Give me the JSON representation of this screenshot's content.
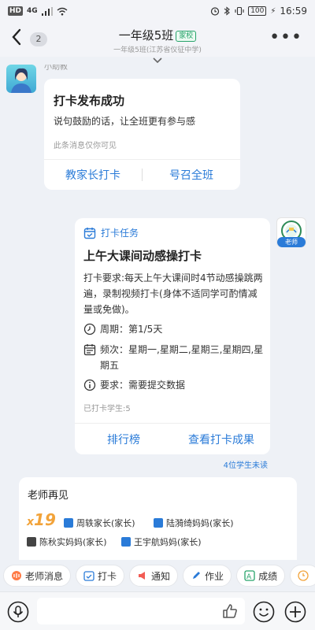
{
  "status_bar": {
    "time": "16:59",
    "network": "4G",
    "battery": "100",
    "hd_label": "HD"
  },
  "header": {
    "back_badge": "2",
    "title": "一年级5班",
    "tag": "家校",
    "subtitle": "一年级5班(江苏省仪征中学)"
  },
  "helper": {
    "name_partial": "小助教"
  },
  "card1": {
    "title": "打卡发布成功",
    "text": "说句鼓励的话，让全班更有参与感",
    "note": "此条消息仅你可见",
    "btn_left": "教家长打卡",
    "btn_right": "号召全班"
  },
  "teacher": {
    "tag": "老师"
  },
  "card2": {
    "head": "打卡任务",
    "title": "上午大课间动感操打卡",
    "requirement": "打卡要求:每天上午大课间时4节动感操跳两遍，录制视频打卡(身体不适同学可酌情减量或免做)。",
    "period": "周期：第1/5天",
    "frequency": "频次：星期一,星期二,星期三,星期四,星期五",
    "require": "要求：需要提交数据",
    "count": "已打卡学生:5",
    "btn_left": "排行榜",
    "btn_right": "查看打卡成果"
  },
  "unread": "4位学生未读",
  "card3": {
    "title": "老师再见",
    "count_prefix": "x",
    "count": "19",
    "people": [
      "周轶家长(家长)",
      "陆漪绮妈妈(家长)",
      "陈秋实妈妈(家长)",
      "王宇航妈妈(家长)"
    ]
  },
  "tabs": [
    "老师消息",
    "打卡",
    "通知",
    "作业",
    "成绩",
    ""
  ],
  "colors": {
    "accent": "#2a7bd8",
    "tag_green": "#27a36a",
    "gold": "#f2a33a"
  }
}
